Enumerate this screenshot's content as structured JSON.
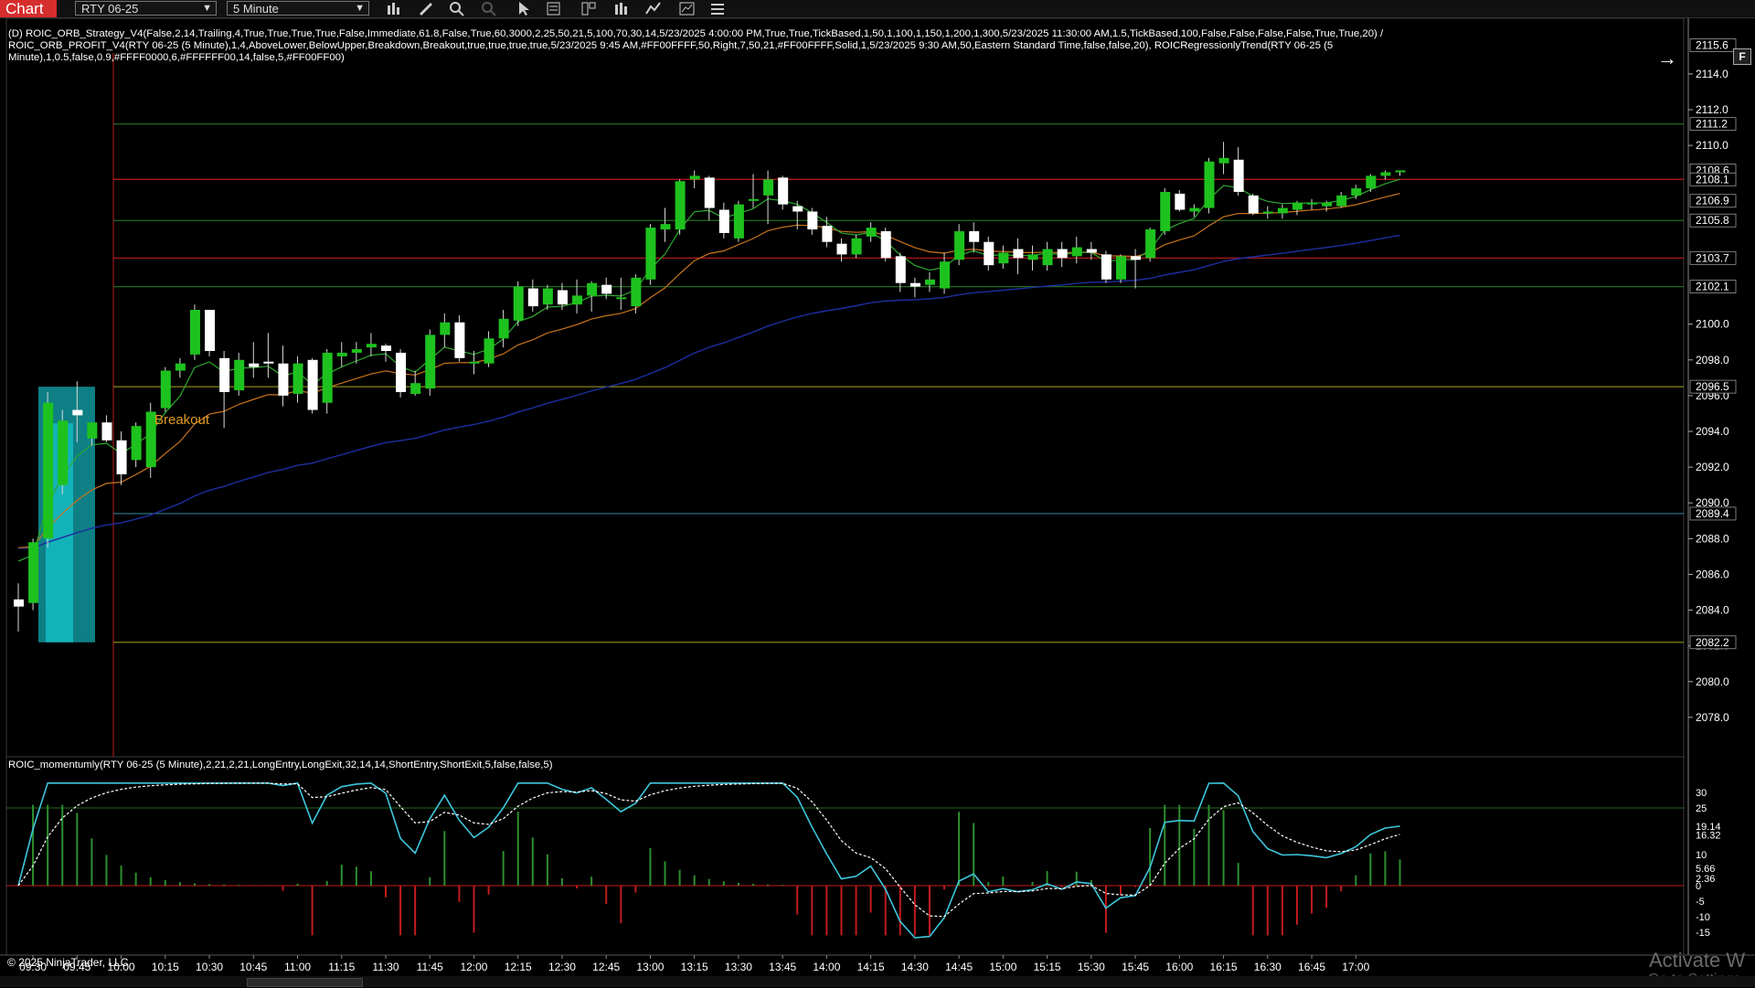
{
  "toolbar": {
    "tab_label": "Chart",
    "instrument": "RTY 06-25",
    "interval": "5 Minute"
  },
  "indicator_header_line1": "(D) ROIC_ORB_Strategy_V4(False,2,14,Trailing,4,True,True,True,True,False,Immediate,61.8,False,True,60,3000,2,25,50,21,5,100,70,30,14,5/23/2025 4:00:00 PM,True,True,TickBased,1,50,1,100,1,150,1,200,1,300,5/23/2025 11:30:00 AM,1.5,TickBased,100,False,False,False,False,True,True,20) /",
  "indicator_header_line2": "ROIC_ORB_PROFIT_V4(RTY 06-25 (5 Minute),1,4,AboveLower,BelowUpper,Breakdown,Breakout,true,true,true,true,5/23/2025 9:45 AM,#FF00FFFF,50,Right,7,50,21,#FF00FFFF,Solid,1,5/23/2025 9:30 AM,50,Eastern Standard Time,false,false,20), ROICRegressionlyTrend(RTY 06-25 (5",
  "indicator_header_line3": "Minute),1,0.5,false,0.9,#FFFF0000,6,#FFFFFF00,14,false,5,#FF00FF00)",
  "momentum_header": "ROIC_momentumly(RTY 06-25 (5 Minute),2,21,2,21,LongEntry,LongExit,32,14,14,ShortEntry,ShortExit,5,false,false,5)",
  "copyright": "© 2025 NinjaTrader, LLC",
  "watermark_line1": "Activate W",
  "watermark_line2": "Go to Settings",
  "f_button": "F",
  "breakout_label": "Breakout",
  "colors": {
    "bull_candle": "#1ec21e",
    "bear_candle": "#ffffff",
    "cyan_box": "#18d4dc",
    "red_line": "#c21c1c",
    "green_line": "#1f6b1f",
    "yellow_line": "#8a8414",
    "teal_line": "#2b7f8f",
    "ema_fast": "#2fa82f",
    "ema_mid": "#c8741e",
    "ema_slow": "#1e2ea0",
    "momentum_line": "#3ec6dc",
    "signal_line": "#ffffff"
  },
  "chart_data": {
    "type": "candlestick",
    "price_axis_ticks": [
      "2114.0",
      "2112.0",
      "2110.0",
      "2100.0",
      "2098.0",
      "2096.0",
      "2094.0",
      "2092.0",
      "2090.0",
      "2088.0",
      "2086.0",
      "2084.0",
      "2082.0",
      "2080.0",
      "2078.0"
    ],
    "price_markers": [
      {
        "label": "2115.6",
        "value": 2115.6
      },
      {
        "label": "2111.2",
        "value": 2111.2
      },
      {
        "label": "2108.6",
        "value": 2108.6
      },
      {
        "label": "2108.1",
        "value": 2108.1
      },
      {
        "label": "2106.9",
        "value": 2106.9
      },
      {
        "label": "2105.8",
        "value": 2105.8
      },
      {
        "label": "2103.7",
        "value": 2103.7
      },
      {
        "label": "2102.1",
        "value": 2102.1
      },
      {
        "label": "2096.5",
        "value": 2096.5
      },
      {
        "label": "2089.4",
        "value": 2089.4
      },
      {
        "label": "2082.2",
        "value": 2082.2
      }
    ],
    "time_axis_labels": [
      "09:30",
      "09:45",
      "10:00",
      "10:15",
      "10:30",
      "10:45",
      "11:00",
      "11:15",
      "11:30",
      "11:45",
      "12:00",
      "12:15",
      "12:30",
      "12:45",
      "13:00",
      "13:15",
      "13:30",
      "13:45",
      "14:00",
      "14:15",
      "14:30",
      "14:45",
      "15:00",
      "15:15",
      "15:30",
      "15:45",
      "16:00",
      "16:15",
      "16:30",
      "16:45",
      "17:00"
    ],
    "candles": [
      [
        2084.6,
        2085.5,
        2082.8,
        2084.2
      ],
      [
        2084.4,
        2088.0,
        2084.0,
        2087.8
      ],
      [
        2088.0,
        2096.2,
        2087.5,
        2095.6
      ],
      [
        2091.0,
        2095.2,
        2090.5,
        2094.6
      ],
      [
        2095.2,
        2096.8,
        2093.4,
        2094.9
      ],
      [
        2093.6,
        2094.5,
        2093.2,
        2094.5
      ],
      [
        2094.5,
        2094.9,
        2093.4,
        2093.5
      ],
      [
        2093.5,
        2094.0,
        2091.0,
        2091.6
      ],
      [
        2092.4,
        2094.5,
        2092.0,
        2094.3
      ],
      [
        2092.0,
        2095.6,
        2091.4,
        2095.1
      ],
      [
        2095.3,
        2097.6,
        2095.1,
        2097.4
      ],
      [
        2097.4,
        2098.1,
        2097.0,
        2097.8
      ],
      [
        2098.3,
        2101.1,
        2098.0,
        2100.8
      ],
      [
        2100.8,
        2100.8,
        2098.2,
        2098.5
      ],
      [
        2098.1,
        2098.5,
        2094.2,
        2096.2
      ],
      [
        2096.3,
        2098.4,
        2096.0,
        2098.0
      ],
      [
        2097.8,
        2099.0,
        2097.0,
        2097.6
      ],
      [
        2097.9,
        2099.5,
        2097.0,
        2097.8
      ],
      [
        2097.8,
        2098.8,
        2095.4,
        2096.0
      ],
      [
        2096.1,
        2098.2,
        2095.6,
        2097.8
      ],
      [
        2098.0,
        2098.1,
        2095.0,
        2095.2
      ],
      [
        2095.6,
        2098.6,
        2095.0,
        2098.4
      ],
      [
        2098.2,
        2099.0,
        2097.6,
        2098.4
      ],
      [
        2098.4,
        2099.0,
        2097.8,
        2098.6
      ],
      [
        2098.7,
        2099.5,
        2098.2,
        2098.9
      ],
      [
        2098.8,
        2098.9,
        2097.9,
        2098.5
      ],
      [
        2098.4,
        2098.6,
        2095.9,
        2096.2
      ],
      [
        2096.1,
        2097.4,
        2096.0,
        2096.7
      ],
      [
        2096.4,
        2099.7,
        2096.0,
        2099.4
      ],
      [
        2099.4,
        2100.6,
        2098.7,
        2100.1
      ],
      [
        2100.1,
        2100.5,
        2097.9,
        2098.1
      ],
      [
        2097.9,
        2098.5,
        2097.2,
        2097.9
      ],
      [
        2097.8,
        2099.6,
        2097.6,
        2099.2
      ],
      [
        2099.2,
        2100.8,
        2098.7,
        2100.3
      ],
      [
        2100.2,
        2102.4,
        2099.9,
        2102.1
      ],
      [
        2102.0,
        2102.5,
        2100.7,
        2101.0
      ],
      [
        2101.1,
        2102.2,
        2100.8,
        2102.0
      ],
      [
        2101.9,
        2102.3,
        2100.8,
        2101.1
      ],
      [
        2101.1,
        2102.5,
        2100.6,
        2101.6
      ],
      [
        2101.6,
        2102.4,
        2100.7,
        2102.3
      ],
      [
        2102.2,
        2102.6,
        2101.4,
        2101.7
      ],
      [
        2101.5,
        2102.6,
        2100.8,
        2101.5
      ],
      [
        2101.0,
        2102.8,
        2100.6,
        2102.6
      ],
      [
        2102.5,
        2105.6,
        2102.2,
        2105.4
      ],
      [
        2105.3,
        2106.5,
        2104.6,
        2105.6
      ],
      [
        2105.3,
        2108.1,
        2105.0,
        2108.0
      ],
      [
        2108.1,
        2108.6,
        2107.6,
        2108.3
      ],
      [
        2108.2,
        2108.3,
        2105.8,
        2106.5
      ],
      [
        2106.4,
        2106.8,
        2104.8,
        2105.1
      ],
      [
        2104.8,
        2106.9,
        2104.6,
        2106.7
      ],
      [
        2106.9,
        2108.4,
        2106.5,
        2107.0
      ],
      [
        2107.2,
        2108.6,
        2105.6,
        2108.1
      ],
      [
        2108.2,
        2108.3,
        2106.4,
        2106.7
      ],
      [
        2106.6,
        2106.9,
        2105.3,
        2106.3
      ],
      [
        2106.3,
        2106.5,
        2105.0,
        2105.3
      ],
      [
        2105.5,
        2106.0,
        2104.3,
        2104.6
      ],
      [
        2104.5,
        2104.8,
        2103.5,
        2103.9
      ],
      [
        2103.9,
        2105.0,
        2103.7,
        2104.8
      ],
      [
        2104.9,
        2105.7,
        2104.6,
        2105.4
      ],
      [
        2105.2,
        2105.4,
        2103.5,
        2103.7
      ],
      [
        2103.8,
        2104.0,
        2101.8,
        2102.3
      ],
      [
        2102.3,
        2102.6,
        2101.5,
        2102.1
      ],
      [
        2102.2,
        2102.9,
        2101.8,
        2102.5
      ],
      [
        2102.0,
        2104.0,
        2101.7,
        2103.5
      ],
      [
        2103.6,
        2105.6,
        2103.3,
        2105.2
      ],
      [
        2105.2,
        2105.7,
        2104.0,
        2104.6
      ],
      [
        2104.6,
        2104.9,
        2103.0,
        2103.3
      ],
      [
        2103.4,
        2104.4,
        2103.1,
        2104.0
      ],
      [
        2104.2,
        2104.8,
        2102.8,
        2103.7
      ],
      [
        2103.6,
        2104.4,
        2103.0,
        2103.9
      ],
      [
        2103.3,
        2104.6,
        2103.0,
        2104.2
      ],
      [
        2104.2,
        2104.6,
        2103.2,
        2103.7
      ],
      [
        2103.8,
        2104.9,
        2103.4,
        2104.3
      ],
      [
        2104.2,
        2104.6,
        2103.6,
        2104.0
      ],
      [
        2103.9,
        2104.1,
        2102.3,
        2102.5
      ],
      [
        2102.5,
        2103.9,
        2102.3,
        2103.8
      ],
      [
        2103.8,
        2104.2,
        2102.0,
        2103.6
      ],
      [
        2103.7,
        2105.4,
        2103.5,
        2105.3
      ],
      [
        2105.2,
        2107.6,
        2105.0,
        2107.4
      ],
      [
        2107.3,
        2107.5,
        2106.3,
        2106.4
      ],
      [
        2106.3,
        2106.7,
        2106.0,
        2106.5
      ],
      [
        2106.5,
        2109.3,
        2106.2,
        2109.1
      ],
      [
        2109.0,
        2110.2,
        2108.4,
        2109.3
      ],
      [
        2109.2,
        2109.9,
        2107.2,
        2107.4
      ],
      [
        2107.2,
        2107.3,
        2106.1,
        2106.2
      ],
      [
        2106.2,
        2106.6,
        2105.9,
        2106.3
      ],
      [
        2106.2,
        2106.7,
        2105.9,
        2106.5
      ],
      [
        2106.4,
        2106.9,
        2106.1,
        2106.8
      ],
      [
        2106.7,
        2107.0,
        2106.4,
        2106.8
      ],
      [
        2106.6,
        2106.9,
        2106.3,
        2106.8
      ],
      [
        2106.6,
        2107.4,
        2106.5,
        2107.2
      ],
      [
        2107.2,
        2107.8,
        2107.0,
        2107.6
      ],
      [
        2107.6,
        2108.4,
        2107.4,
        2108.3
      ],
      [
        2108.3,
        2108.6,
        2108.1,
        2108.5
      ],
      [
        2108.5,
        2108.6,
        2108.3,
        2108.6
      ]
    ],
    "orb_box": {
      "high": 2096.5,
      "low": 2082.2
    },
    "horizontal_lines": [
      {
        "value": 2111.2,
        "style": "green"
      },
      {
        "value": 2108.1,
        "style": "red"
      },
      {
        "value": 2105.8,
        "style": "green"
      },
      {
        "value": 2103.7,
        "style": "red"
      },
      {
        "value": 2102.1,
        "style": "green"
      },
      {
        "value": 2096.5,
        "style": "yellow"
      },
      {
        "value": 2089.4,
        "style": "teal"
      },
      {
        "value": 2082.2,
        "style": "yellow"
      }
    ],
    "momentum": {
      "axis_ticks": [
        "30",
        "25",
        "19.14",
        "16.32",
        "10",
        "5.66",
        "2.36",
        "0",
        "-5",
        "-10",
        "-15"
      ],
      "line_markers": {
        "momentum": 19.14,
        "signal": 16.32
      },
      "ylim": [
        -20,
        35
      ]
    }
  }
}
